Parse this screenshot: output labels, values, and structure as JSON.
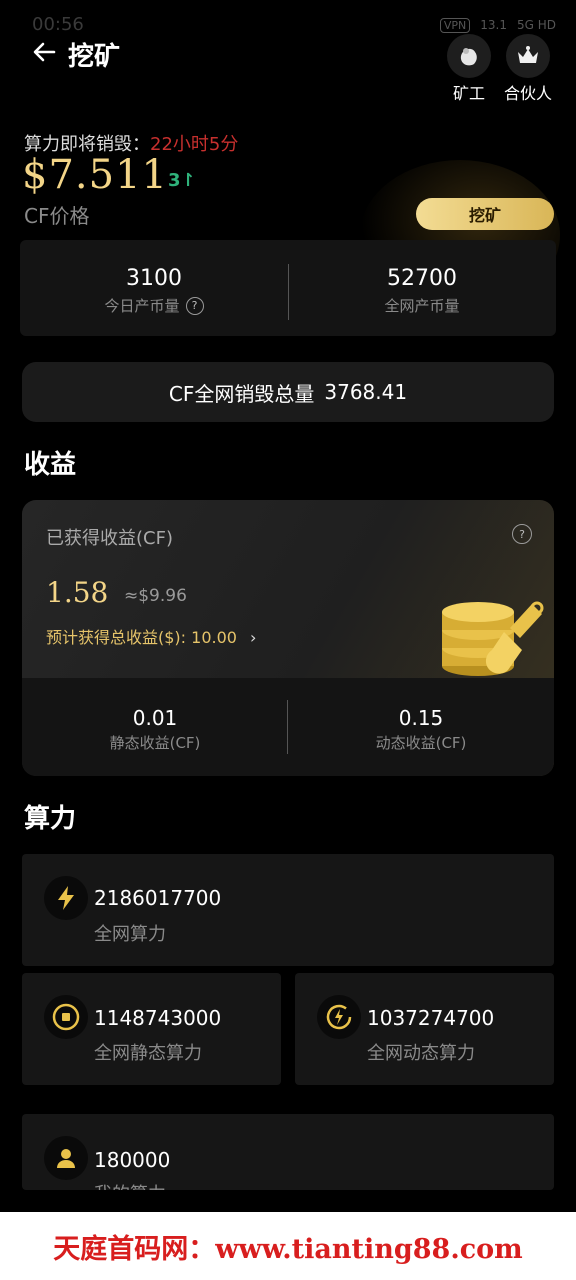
{
  "status": {
    "time": "00:56",
    "vpn": "VPN",
    "net_speed": "13.1",
    "net_unit": "KB/s",
    "net_type": "5G HD"
  },
  "header": {
    "title": "挖矿",
    "miner_label": "矿工",
    "partner_label": "合伙人"
  },
  "price": {
    "destroy_label": "算力即将销毁：",
    "destroy_countdown": "22小时5分",
    "value": "$7.511",
    "trend": "3",
    "price_label": "CF价格",
    "mine_button": "挖矿"
  },
  "stats": {
    "today_value": "3100",
    "today_label": "今日产币量",
    "network_value": "52700",
    "network_label": "全网产币量"
  },
  "destroyed": {
    "label": "CF全网销毁总量",
    "value": "3768.41"
  },
  "earnings": {
    "section_title": "收益",
    "earned_label": "已获得收益(CF)",
    "earned_value": "1.58",
    "earned_usd": "≈$9.96",
    "expected_label": "预计获得总收益($): 10.00",
    "static_value": "0.01",
    "static_label": "静态收益(CF)",
    "dynamic_value": "0.15",
    "dynamic_label": "动态收益(CF)"
  },
  "power": {
    "section_title": "算力",
    "network_value": "2186017700",
    "network_label": "全网算力",
    "static_value": "1148743000",
    "static_label": "全网静态算力",
    "dynamic_value": "1037274700",
    "dynamic_label": "全网动态算力",
    "mine_value": "180000",
    "mine_label": "我的算力"
  },
  "watermark": "天庭首码网：www.tianting88.com",
  "colors": {
    "gold": "#f3d588",
    "red": "#c7302e",
    "green": "#2fb27b",
    "card": "#161616"
  }
}
